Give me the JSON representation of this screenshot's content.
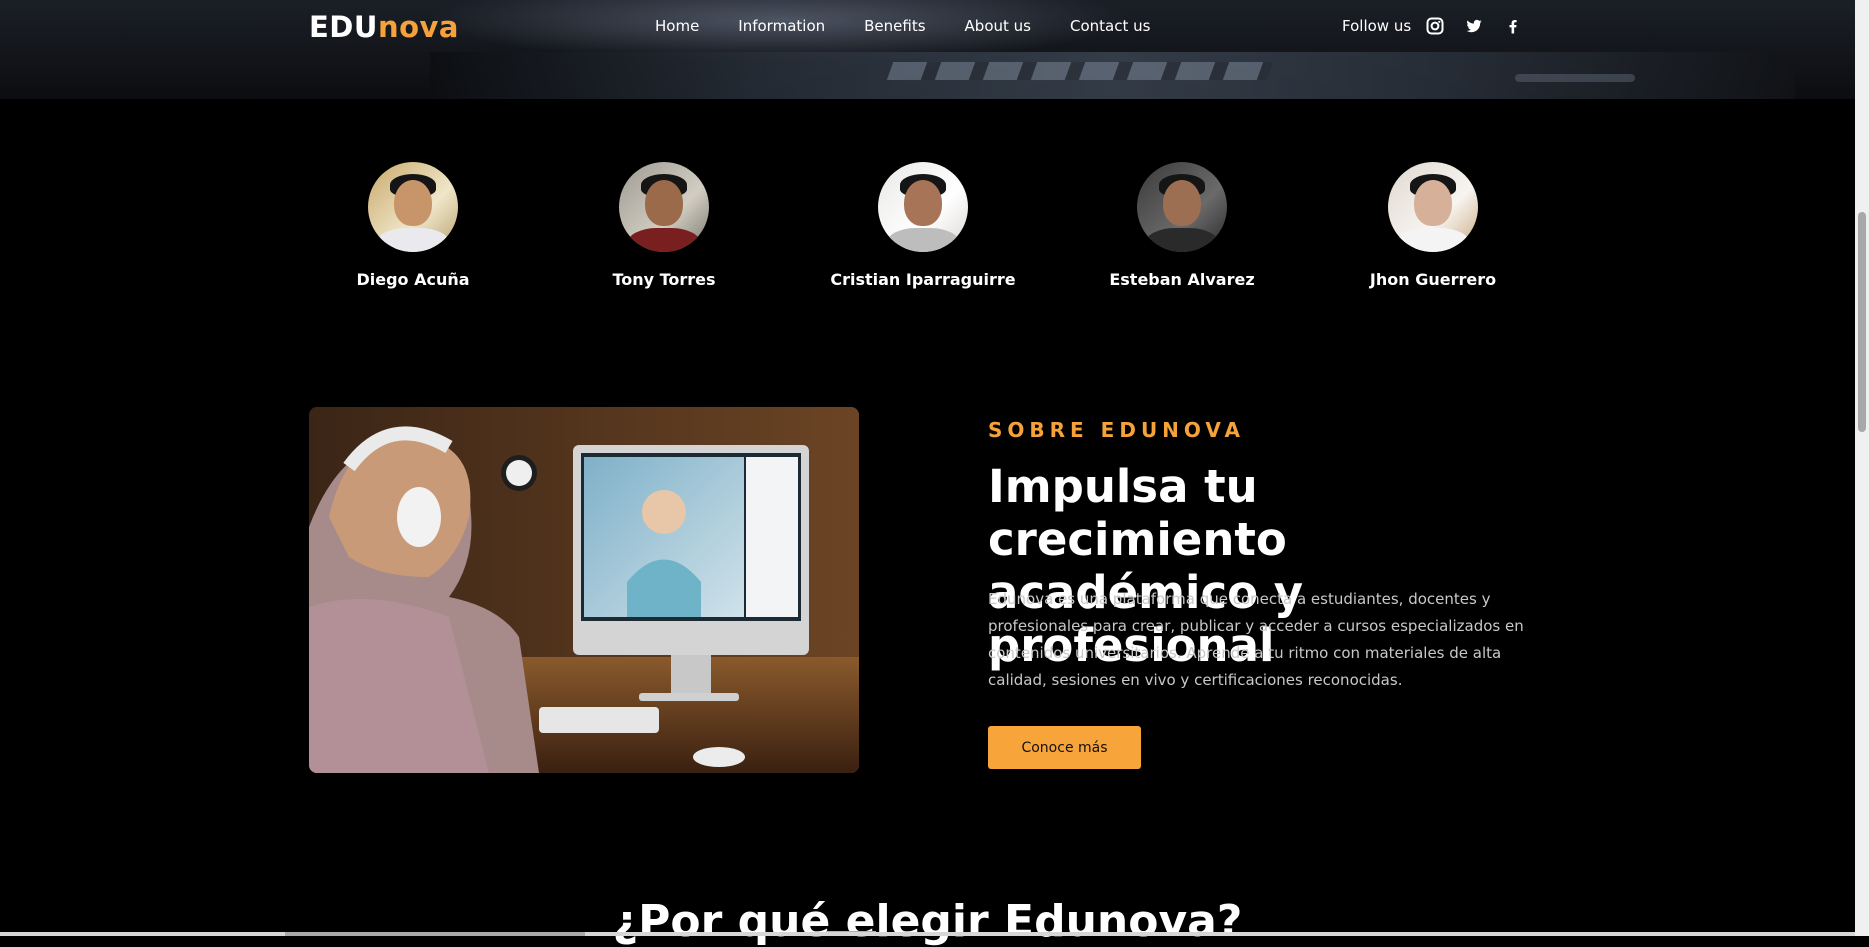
{
  "header": {
    "logo_part1": "EDU",
    "logo_part2": "nova",
    "nav": [
      "Home",
      "Information",
      "Benefits",
      "About us",
      "Contact us"
    ],
    "follow_label": "Follow us",
    "social_icons": [
      "instagram-icon",
      "twitter-icon",
      "facebook-icon"
    ]
  },
  "team": [
    {
      "name": "Diego Acuña"
    },
    {
      "name": "Tony Torres"
    },
    {
      "name": "Cristian Iparraguirre"
    },
    {
      "name": "Esteban Alvarez"
    },
    {
      "name": "Jhon Guerrero"
    }
  ],
  "about": {
    "eyebrow": "SOBRE EDUNOVA",
    "headline": "Impulsa tu crecimiento académico y profesional",
    "description": "Edunova es una plataforma que conecta a estudiantes, docentes y profesionales para crear, publicar y acceder a cursos especializados en contenidos universitarios. Aprende a tu ritmo con materiales de alta calidad, sesiones en vivo y certificaciones reconocidas.",
    "button": "Conoce más"
  },
  "why": {
    "title": "¿Por qué elegir Edunova?"
  },
  "colors": {
    "accent": "#f5a23b",
    "background": "#000000"
  }
}
